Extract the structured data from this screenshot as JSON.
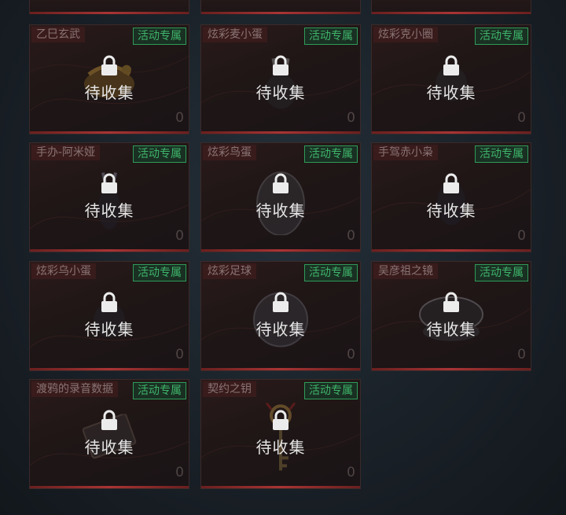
{
  "cards": [
    {
      "name": "乙巳玄武",
      "tag": "活动专属",
      "status": "待收集",
      "count": "0",
      "item_icon": "black-tortoise-icon"
    },
    {
      "name": "炫彩麦小蛋",
      "tag": "活动专属",
      "status": "待收集",
      "count": "0",
      "item_icon": "rabbit-figure-icon"
    },
    {
      "name": "炫彩克小圈",
      "tag": "活动专属",
      "status": "待收集",
      "count": "0",
      "item_icon": "round-figure-icon"
    },
    {
      "name": "手办-阿米娅",
      "tag": "活动专属",
      "status": "待收集",
      "count": "0",
      "item_icon": "figure-icon"
    },
    {
      "name": "炫彩鸟蛋",
      "tag": "活动专属",
      "status": "待收集",
      "count": "0",
      "item_icon": "egg-icon"
    },
    {
      "name": "手驾赤小枭",
      "tag": "活动专属",
      "status": "待收集",
      "count": "0",
      "item_icon": "owl-figure-icon"
    },
    {
      "name": "炫彩乌小蛋",
      "tag": "活动专属",
      "status": "待收集",
      "count": "0",
      "item_icon": "crow-figure-icon"
    },
    {
      "name": "炫彩足球",
      "tag": "活动专属",
      "status": "待收集",
      "count": "0",
      "item_icon": "football-icon"
    },
    {
      "name": "吴彦祖之镜",
      "tag": "活动专属",
      "status": "待收集",
      "count": "0",
      "item_icon": "mirror-icon"
    },
    {
      "name": "渡鸦的录音数据",
      "tag": "活动专属",
      "status": "待收集",
      "count": "0",
      "item_icon": "cassette-icon"
    },
    {
      "name": "契约之钥",
      "tag": "活动专属",
      "status": "待收集",
      "count": "0",
      "item_icon": "key-icon"
    }
  ],
  "colors": {
    "tag_green": "#3fb46a",
    "accent_red": "#a83434"
  }
}
